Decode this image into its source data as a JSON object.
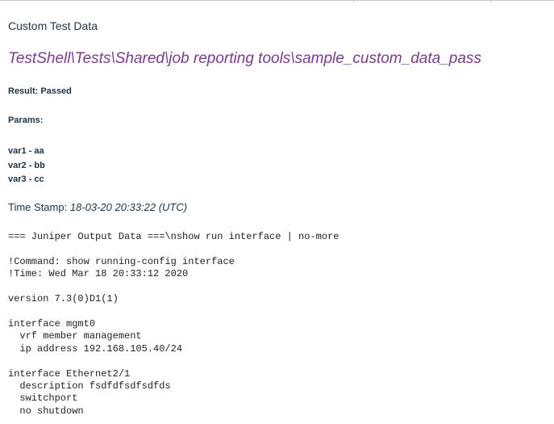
{
  "report": {
    "heading": "Custom Test Data",
    "test_path": "TestShell\\Tests\\Shared\\job reporting tools\\sample_custom_data_pass",
    "result_line": "Result: Passed",
    "params_heading": "Params:",
    "params": [
      "var1 - aa",
      "var2 - bb",
      "var3 - cc"
    ],
    "timestamp_label": "Time Stamp: ",
    "timestamp_value": "18-03-20 20:33:22 (UTC)"
  },
  "output": {
    "header": "=== Juniper Output Data ===\\nshow run interface | no-more",
    "lines": [
      "!Command: show running-config interface",
      "!Time: Wed Mar 18 20:33:12 2020",
      "",
      "version 7.3(0)D1(1)",
      "",
      "interface mgmt0",
      "  vrf member management",
      "  ip address 192.168.105.40/24",
      "",
      "interface Ethernet2/1",
      "  description fsdfdfsdfsdfds",
      "  switchport",
      "  no shutdown"
    ]
  }
}
